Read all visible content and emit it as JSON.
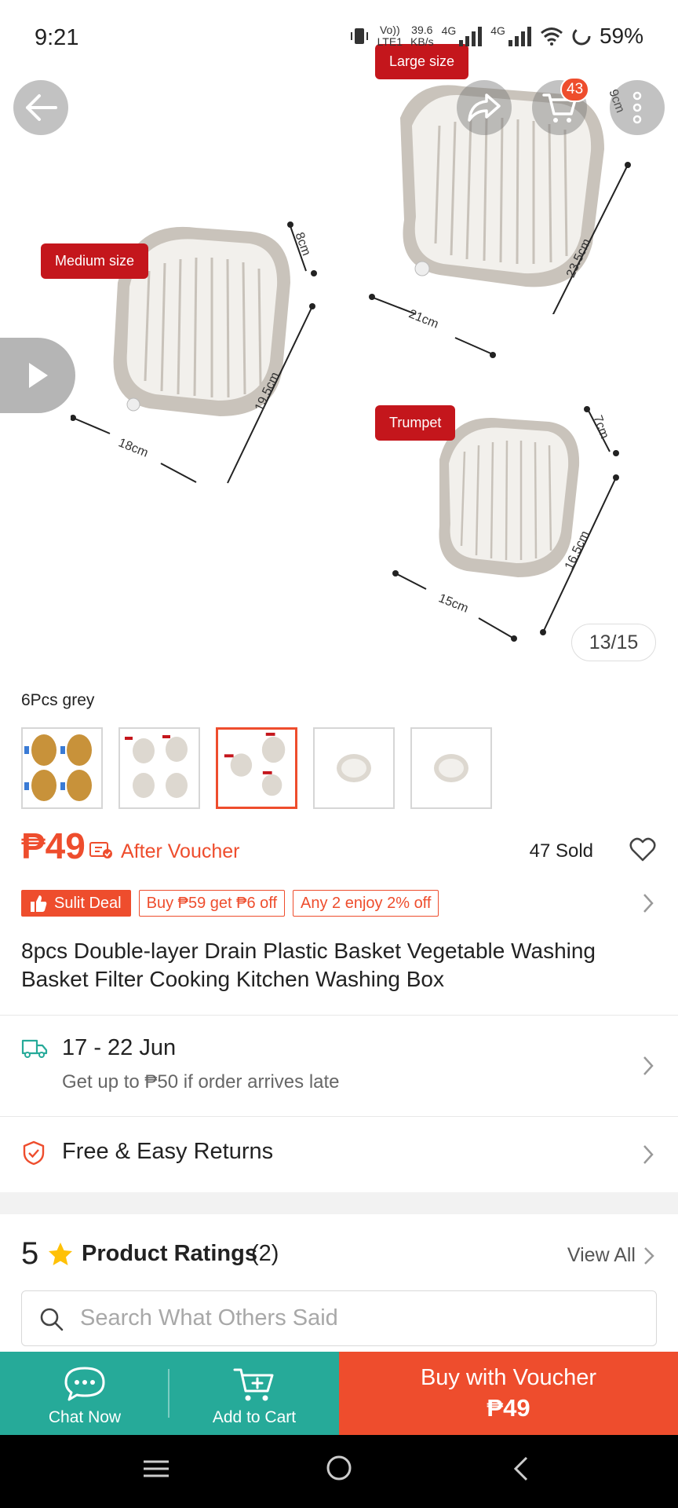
{
  "status_bar": {
    "time": "9:21",
    "net_speed_top": "39.6",
    "net_speed_unit": "KB/s",
    "net_lte": "LTE1",
    "net_vo": "Vo))",
    "sig1": "4G",
    "sig2": "4G",
    "battery": "59%"
  },
  "hero": {
    "cart_count": "43",
    "image_counter": "13/15",
    "tags": {
      "large": "Large size",
      "medium": "Medium size",
      "trumpet": "Trumpet"
    },
    "dimensions": {
      "large_h": "9cm",
      "large_l": "23.5cm",
      "large_w": "21cm",
      "medium_h": "8cm",
      "medium_l": "19.5cm",
      "medium_w": "18cm",
      "trumpet_h": "7cm",
      "trumpet_l": "16.5cm",
      "trumpet_w": "15cm"
    }
  },
  "variation": {
    "selected_label": "6Pcs grey",
    "thumb_count": 5,
    "selected_index": 2
  },
  "price": {
    "value": "₱49",
    "after_voucher": "After Voucher",
    "sold": "47 Sold"
  },
  "deals": {
    "sulit": "Sulit Deal",
    "tag1": "Buy ₱59 get ₱6 off",
    "tag2": "Any 2 enjoy 2% off"
  },
  "product": {
    "title": "8pcs Double-layer Drain Plastic Basket Vegetable Washing Basket Filter Cooking Kitchen Washing Box"
  },
  "delivery": {
    "dates": "17 - 22 Jun",
    "guarantee": "Get up to ₱50 if order arrives late"
  },
  "returns": {
    "label": "Free & Easy Returns"
  },
  "ratings": {
    "score": "5",
    "title": "Product Ratings",
    "count": "(2)",
    "view_all": "View All",
    "search_placeholder": "Search What Others Said"
  },
  "actions": {
    "chat": "Chat Now",
    "add_cart": "Add to Cart",
    "buy_label": "Buy with Voucher",
    "buy_price": "₱49"
  },
  "colors": {
    "brand": "#ee4d2d",
    "teal": "#26aa99",
    "tag_red": "#c4161c"
  }
}
